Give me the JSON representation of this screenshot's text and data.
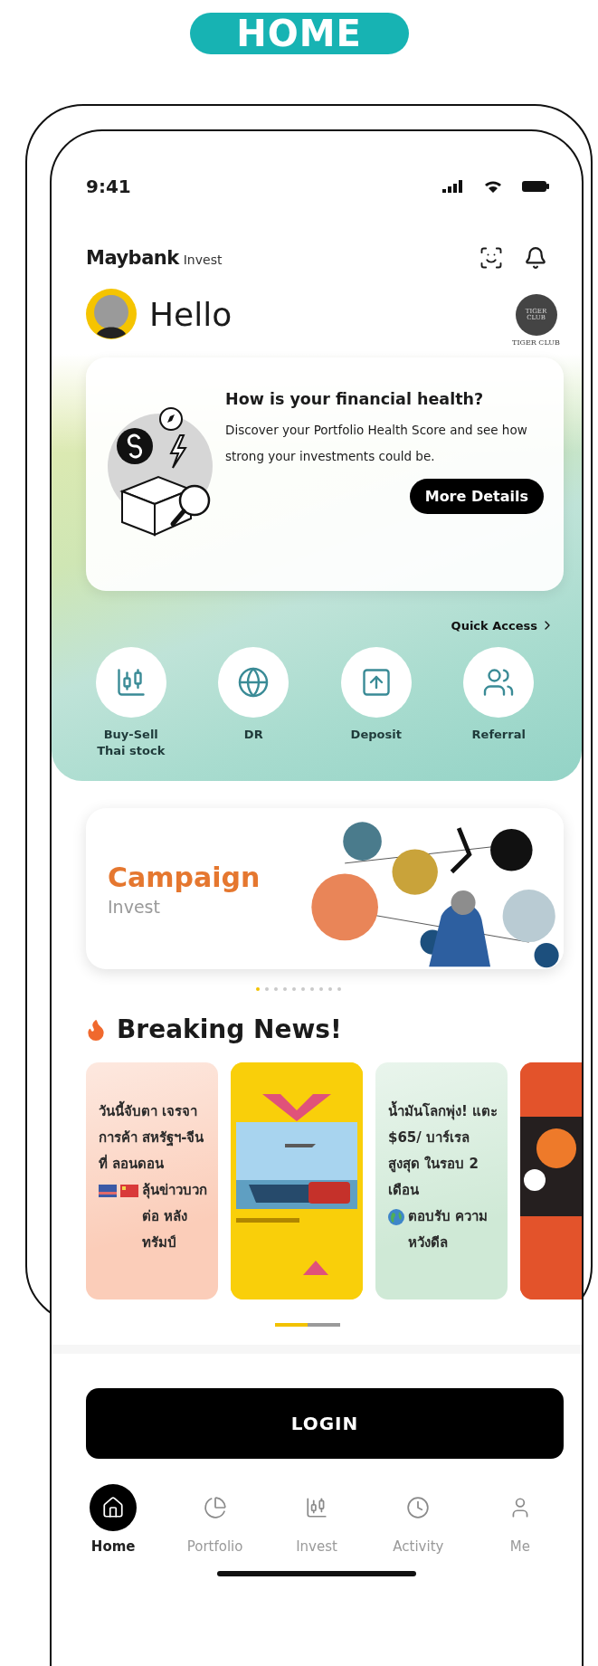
{
  "header_badge": "HOME",
  "status_bar": {
    "time": "9:41"
  },
  "app_bar": {
    "brand": "Maybank",
    "brand_suffix": "Invest"
  },
  "greeting": {
    "text": "Hello",
    "club_logo": "TIGER CLUB",
    "club_label": "TIGER CLUB"
  },
  "health_card": {
    "title": "How is your financial health?",
    "body": "Discover your Portfolio Health Score and see how strong your investments could be.",
    "button": "More Details"
  },
  "quick_access": {
    "link": "Quick Access",
    "items": [
      {
        "kind": "stock",
        "label": "Buy-Sell Thai stock"
      },
      {
        "kind": "globe",
        "label": "DR"
      },
      {
        "kind": "deposit",
        "label": "Deposit"
      },
      {
        "kind": "referral",
        "label": "Referral"
      }
    ]
  },
  "campaign": {
    "title": "Campaign",
    "subtitle": "Invest",
    "dots": [
      {
        "selected": true
      },
      {
        "selected": false
      },
      {
        "selected": false
      },
      {
        "selected": false
      },
      {
        "selected": false
      },
      {
        "selected": false
      },
      {
        "selected": false
      },
      {
        "selected": false
      },
      {
        "selected": false
      },
      {
        "selected": false
      }
    ]
  },
  "news": {
    "title": "Breaking News!",
    "cards": [
      {
        "kind": "flags",
        "color": "#fbcdb9",
        "text": "วันนี้จับตา เจรจาการค้า สหรัฐฯ-จีนที่ ลอนดอน",
        "text_end": "ลุ้นข่าวบวก ต่อ หลังทรัมป์"
      },
      {
        "kind": "picture",
        "color": "#f9cf0a"
      },
      {
        "kind": "globe",
        "color": "#cfe9d6",
        "text": "น้ำมันโลกพุ่ง! แตะ $65/ บาร์เรล สูงสุด ในรอบ 2 เดือน",
        "text_end": "ตอบรับ ความหวังดีล"
      },
      {
        "kind": "picture",
        "color": "#e3532b"
      }
    ],
    "pager": [
      {
        "selected": true
      },
      {
        "selected": false
      }
    ]
  },
  "login_button": "LOGIN",
  "tabs": [
    {
      "kind": "home",
      "label": "Home",
      "selected": true
    },
    {
      "kind": "portfolio",
      "label": "Portfolio",
      "selected": false
    },
    {
      "kind": "invest",
      "label": "Invest",
      "selected": false
    },
    {
      "kind": "activity",
      "label": "Activity",
      "selected": false
    },
    {
      "kind": "me",
      "label": "Me",
      "selected": false
    }
  ]
}
